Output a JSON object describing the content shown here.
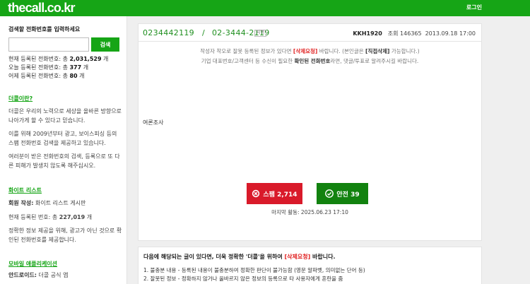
{
  "header": {
    "logo": "thecall.co.kr",
    "login": "로그인"
  },
  "sidebar": {
    "search_title": "검색할 전화번호를 입력하세요",
    "search_placeholder": "",
    "search_button": "검색",
    "stats": {
      "total_label": "현재 등록된 전화번호: 총 ",
      "total_value": "2,031,529",
      "total_unit": " 개",
      "today_label": "오늘 등록된 전화번호: 총 ",
      "today_value": "377",
      "today_unit": " 개",
      "yesterday_label": "어제 등록된 전화번호: 총 ",
      "yesterday_value": "80",
      "yesterday_unit": " 개"
    },
    "about": {
      "heading": "더콜이란?",
      "p1": "더콜은 우리의 노력으로 세상을 올바른 방향으로 나아가게 할 수 있다고 믿습니다.",
      "p2": "이를 위해 2009년부터 광고, 보이스피싱 등의 스팸 전화번호 검색을 제공하고 있습니다.",
      "p3": "여러분이 받은 전화번호의 검색, 등록으로 또 다른 피해가 발생치 않도록 해주십시오."
    },
    "whitelist": {
      "heading": "화이트 리스트",
      "author_label": "회원 작성:",
      "author_value": " 화이트 리스트 게시판",
      "count_label": "현재 등록된 번호: 총 ",
      "count_value": "227,019",
      "count_unit": " 개",
      "desc": "정확한 정보 제공을 위해, 광고가 아닌 것으로 확인된 전화번호를 제공합니다."
    },
    "mobile": {
      "heading": "모바일 애플리케이션",
      "android_label": "안드로이드:",
      "android_value": " 더콜 공식 앱"
    }
  },
  "main": {
    "phone1": "0234442119",
    "separator": "/",
    "phone2": "02-3444-2119",
    "region_badge": "지역",
    "user_code": "KKH1920",
    "views_label": "조회 ",
    "views_value": "146365",
    "date": "2013.09.18 17:00",
    "notice1_a": "작성자 착오로 잘못 등록된 정보가 있다면 ",
    "notice1_b": "[삭제요청]",
    "notice1_c": " 바랍니다. (본인글은 ",
    "notice1_d": "[직접삭제]",
    "notice1_e": " 가능합니다.)",
    "notice2_a": "기업 대표번호/고객센터 등 수신이 필요한 ",
    "notice2_b": "확인된 전화번호",
    "notice2_c": "라면, 댓글/투표로 알려주시길 바랍니다.",
    "content": "여론조사",
    "spam_label": "스팸 2,714",
    "safe_label": "안전 39",
    "last_activity": "마지막 활동: 2025.06.23 17:10"
  },
  "report": {
    "title_a": "다음에 해당되는 글이 있다면, 더욱 정확한 '더콜'을 위하여 ",
    "title_b": "[삭제요청]",
    "title_c": " 바랍니다.",
    "items": [
      "1. 불충분 내용 - 등록된 내용이 불충분하여 정확한 판단이 불가능함 (영문 알파벳, 의미없는 단어 등)",
      "2. 잘못된 정보 - 정확하지 않거나 올바르지 않은 정보의 등록으로 타 사용자에게 혼란을 줌"
    ]
  },
  "colors": {
    "brand_green": "#16a516",
    "spam_red": "#d91a2a",
    "safe_green": "#12820f",
    "phone_green": "#1f8f1f",
    "notice_red": "#e02020"
  }
}
